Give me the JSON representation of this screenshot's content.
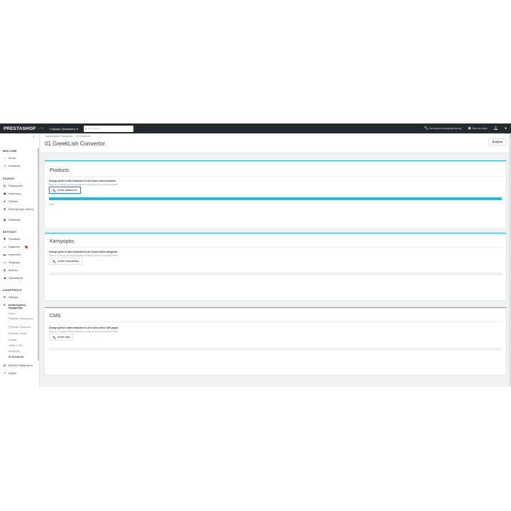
{
  "topbar": {
    "logo": "PRESTASHOP",
    "version": "1.7.6",
    "quick_access": "Γρήγορη Πρόσβαση",
    "search_placeholder": "Αναζήτηση",
    "debug_mode": "Λειτουργία αποσφαλμάτωσης",
    "view_store": "View my store"
  },
  "sidebar": {
    "sections": [
      {
        "label": "WELCOME"
      },
      {
        "label": "ΠΩΛΗΣΗ"
      },
      {
        "label": "ΒΕΛΤΙΩΣΗ"
      },
      {
        "label": "ΔΙΑΜΟΡΦΩΣΗ"
      }
    ],
    "items": [
      {
        "label": "Home"
      },
      {
        "label": "Στατιστικά"
      },
      {
        "label": "Παραγγελίες"
      },
      {
        "label": "Κατάλογος"
      },
      {
        "label": "Πελάτες"
      },
      {
        "label": "Εξυπηρέτηση πελάτη"
      },
      {
        "label": "Στατιστικά"
      },
      {
        "label": "Προσθέτα"
      },
      {
        "label": "Εμφάνιση"
      },
      {
        "label": "Αποστολή"
      },
      {
        "label": "Πληρωμή"
      },
      {
        "label": "Διεθνής"
      },
      {
        "label": "Προωθήσεις"
      },
      {
        "label": "Settings"
      },
      {
        "label": "Καταστήματος Παράμετροι"
      },
      {
        "label": "Εξέλιξη Παράμετρων"
      },
      {
        "label": "Αρχικό"
      }
    ],
    "subitems": [
      {
        "label": "Γενικά"
      },
      {
        "label": "Ρυθμίσεις Παραγγελιών"
      },
      {
        "label": "Ρυθμίσεις Προϊόντων"
      },
      {
        "label": "Ρυθμίσεις πελάτη"
      },
      {
        "label": "Επαφές"
      },
      {
        "label": "Traffic & SEO"
      },
      {
        "label": "Αναζήτηση"
      },
      {
        "label": "01 GreekLish"
      }
    ]
  },
  "header": {
    "breadcrumb": [
      "Καταστήματος Παράμετροι",
      "01 GreekLish"
    ],
    "title": "01 GreekLish Convertor",
    "help": "Βοήθεια"
  },
  "panels": [
    {
      "title": "Products",
      "description": "Change greek to latin characters to all of your active products.",
      "note": "Click on to change all Greek characters to latin for all of your product URLS!",
      "button": "START PRODUCTS",
      "progress": 1.0,
      "progress_label": "100%"
    },
    {
      "title": "Κατηγορίες",
      "description": "Change greek to latin characters to all of your active categories.",
      "note": "Click on to change all Greek characters to latin for all of your product URLS!",
      "button": "START CATEGORIES",
      "progress": 0
    },
    {
      "title": "CMS",
      "description": "Change greek to latin characters to all of your active CMS pages.",
      "note": "Click on to change all Greek characters to latin for all of your product URLS!",
      "button": "START CMS",
      "progress": 0
    }
  ]
}
